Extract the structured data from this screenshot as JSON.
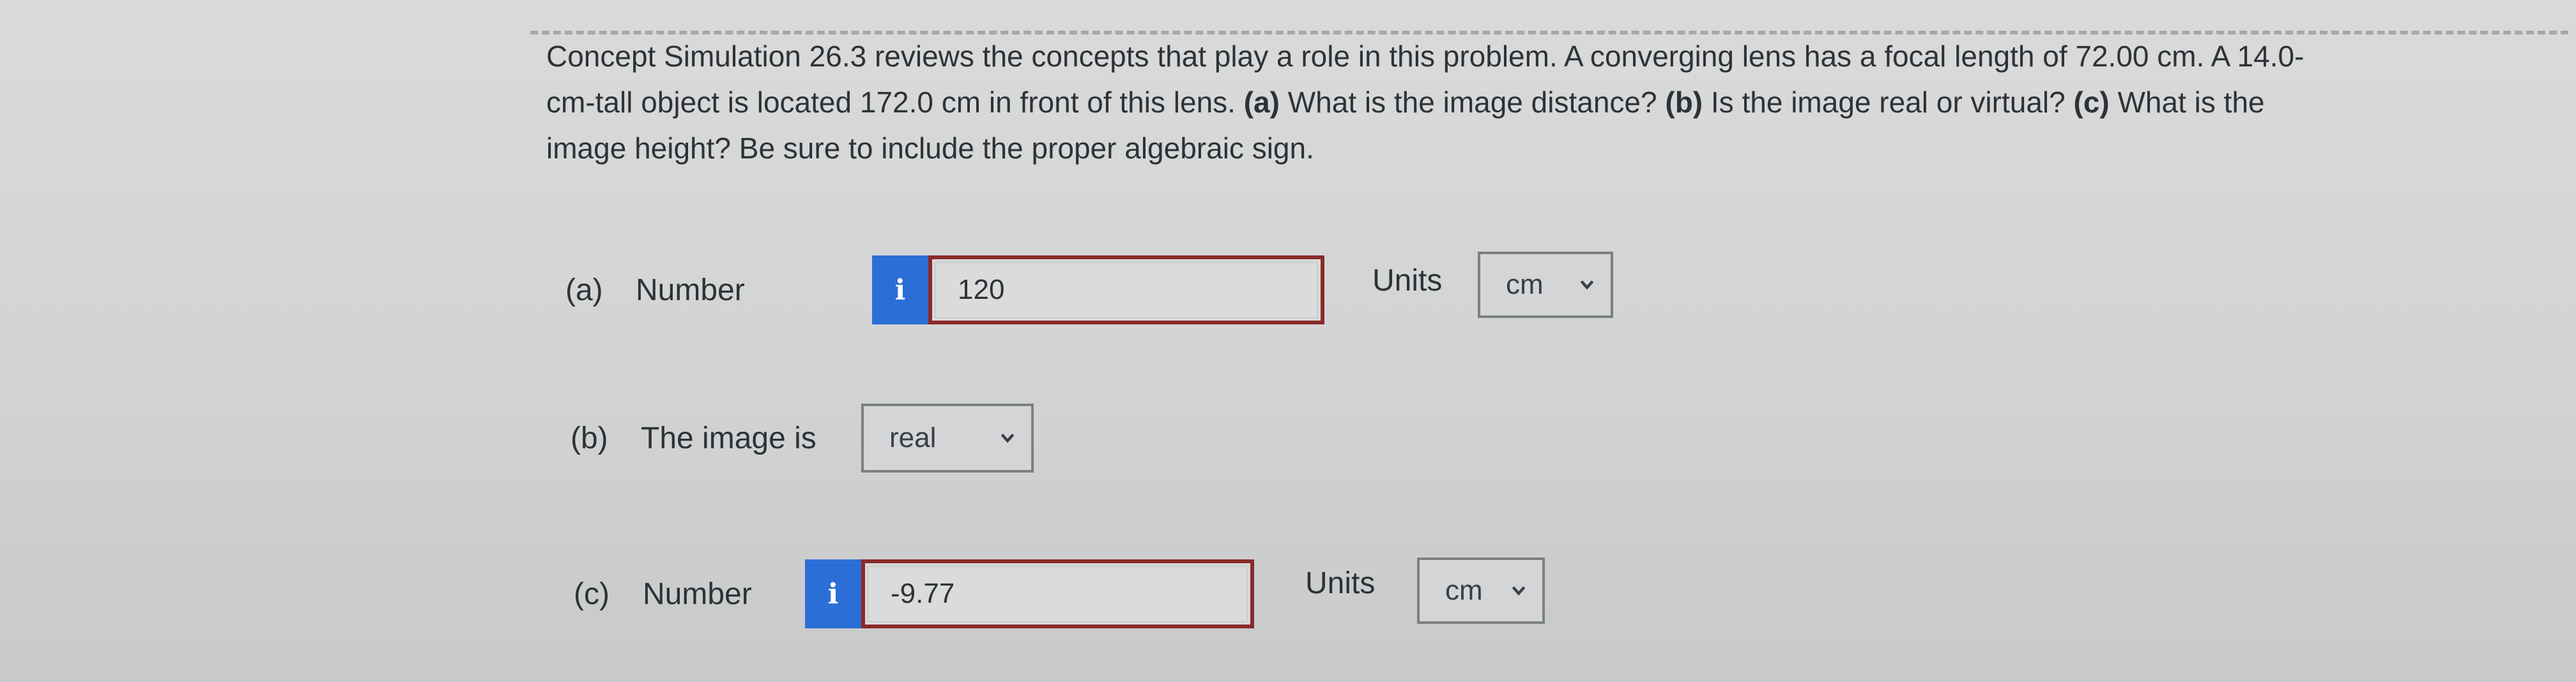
{
  "question": {
    "line1_pre": "Concept Simulation 26.3 reviews the concepts that play a role in this problem. A converging lens has a focal length of 72.00 cm. A 14.0-",
    "line2_pre": "cm-tall object is located 172.0 cm in front of this lens. ",
    "part_a_marker": "(a)",
    "part_a_text": " What is the image distance? ",
    "part_b_marker": "(b)",
    "part_b_text": " Is the image real or virtual? ",
    "part_c_marker": "(c)",
    "part_c_text": " What is the",
    "line3": "image height? Be sure to include the proper algebraic sign."
  },
  "part_a": {
    "label": "(a)",
    "field_label": "Number",
    "info": "i",
    "value": "120",
    "units_label": "Units",
    "units_value": "cm"
  },
  "part_b": {
    "label": "(b)",
    "field_label": "The image is",
    "value": "real"
  },
  "part_c": {
    "label": "(c)",
    "field_label": "Number",
    "info": "i",
    "value": "-9.77",
    "units_label": "Units",
    "units_value": "cm"
  },
  "icons": {
    "info": "info-icon",
    "dropdown": "chevron-down-icon"
  },
  "colors": {
    "info_button": "#2b6fd6",
    "input_border": "#8a2a2a",
    "background": "#d6d7d7"
  }
}
